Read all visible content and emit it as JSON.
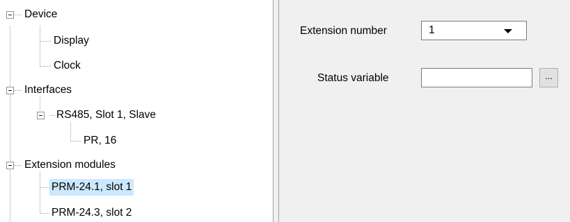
{
  "tree": {
    "nodes": [
      {
        "label": "Device",
        "expanded": true
      },
      {
        "label": "Display"
      },
      {
        "label": "Clock"
      },
      {
        "label": "Interfaces",
        "expanded": true
      },
      {
        "label": "RS485, Slot 1, Slave",
        "expanded": true
      },
      {
        "label": "PR, 16"
      },
      {
        "label": "Extension modules",
        "expanded": true
      },
      {
        "label": "PRM-24.1, slot 1",
        "selected": true
      },
      {
        "label": "PRM-24.3, slot 2"
      }
    ]
  },
  "properties": {
    "extension_number": {
      "label": "Extension number",
      "value": "1"
    },
    "status_variable": {
      "label": "Status variable",
      "value": "",
      "browse_label": "..."
    }
  },
  "colors": {
    "selection": "#cce8ff",
    "panel_background": "#f0f0f0",
    "tree_lines": "#a0a0a0"
  }
}
